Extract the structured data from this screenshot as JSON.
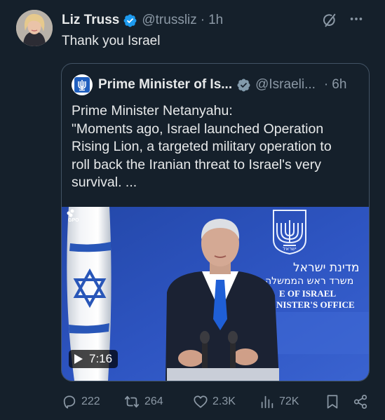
{
  "tweet": {
    "author_name": "Liz Truss",
    "handle": "@trussliz",
    "separator": "·",
    "time": "1h",
    "text": "Thank you Israel"
  },
  "quote": {
    "author_name": "Prime Minister of Is...",
    "handle": "@Israeli...",
    "separator": "·",
    "time": "6h",
    "text_lines": [
      "Prime Minister Netanyahu:",
      "\"Moments ago, Israel launched Operation",
      "Rising Lion, a targeted military operation to",
      "roll back the Iranian threat to Israel's very",
      "survival. ..."
    ],
    "media": {
      "duration": "7:16",
      "watermark": "GPO",
      "sign_hebrew_1": "מדינת ישראל",
      "sign_hebrew_2": "משרד ראש הממשלה",
      "sign_english_1": "E OF ISRAEL",
      "sign_english_2": "NISTER'S OFFICE",
      "emblem_text": "ישראל"
    }
  },
  "actions": {
    "replies": "222",
    "reposts": "264",
    "likes": "2.3K",
    "views": "72K"
  },
  "colors": {
    "background": "#15202b",
    "verified": "#1d9bf0",
    "muted": "#8b98a5",
    "stage_blue": "#2b4db3"
  }
}
